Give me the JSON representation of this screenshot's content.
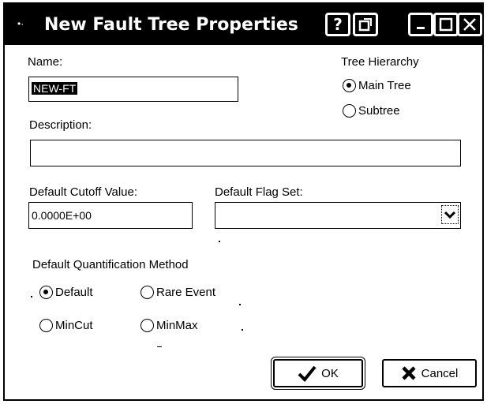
{
  "window": {
    "title": "New Fault Tree Properties",
    "sysmenu_glyph": "•·",
    "help_label": "?"
  },
  "form": {
    "name_label": "Name:",
    "name_value": "NEW-FT",
    "description_label": "Description:",
    "description_value": "",
    "hierarchy_label": "Tree Hierarchy",
    "hierarchy_options": [
      {
        "label": "Main Tree",
        "checked": true
      },
      {
        "label": "Subtree",
        "checked": false
      }
    ],
    "cutoff_label": "Default Cutoff Value:",
    "cutoff_value": "0.0000E+00",
    "flagset_label": "Default Flag Set:",
    "flagset_value": "",
    "quant_label": "Default Quantification Method",
    "quant_options": [
      {
        "label": "Default",
        "checked": true
      },
      {
        "label": "Rare Event",
        "checked": false
      },
      {
        "label": "MinCut",
        "checked": false
      },
      {
        "label": "MinMax",
        "checked": false
      }
    ]
  },
  "buttons": {
    "ok_label": "OK",
    "cancel_label": "Cancel"
  },
  "icons": {
    "help": "question-mark-icon",
    "restore": "restore-window-icon",
    "minimize": "minimize-icon",
    "maximize": "maximize-icon",
    "close": "close-icon",
    "ok": "checkmark-icon",
    "cancel": "x-mark-icon",
    "dropdown": "chevron-down-icon"
  }
}
